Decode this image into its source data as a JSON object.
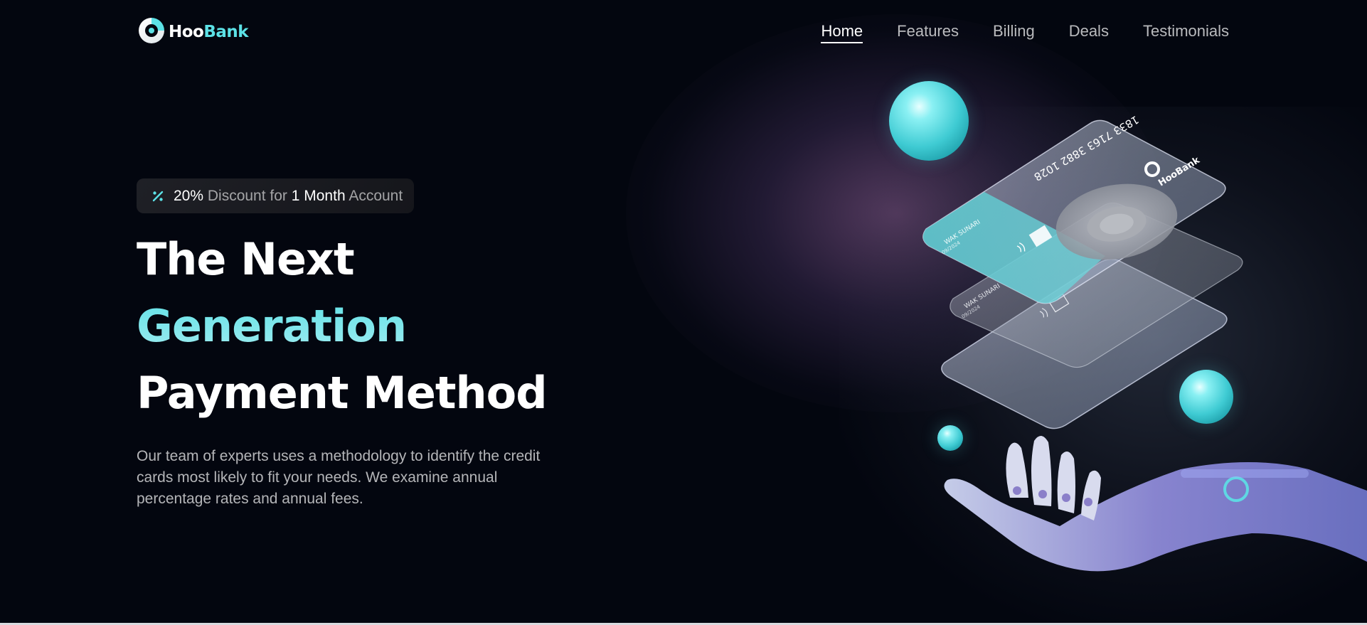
{
  "brand": {
    "name_part1": "Hoo",
    "name_part2": "Bank",
    "accent_color": "#5ce1e6"
  },
  "nav": {
    "links": [
      {
        "label": "Home",
        "active": true
      },
      {
        "label": "Features",
        "active": false
      },
      {
        "label": "Billing",
        "active": false
      },
      {
        "label": "Deals",
        "active": false
      },
      {
        "label": "Testimonials",
        "active": false
      }
    ]
  },
  "hero": {
    "badge": {
      "icon": "percent-icon",
      "percent": "20%",
      "text1": " Discount for ",
      "duration": "1 Month",
      "text2": " Account"
    },
    "title_line1": "The Next",
    "title_line2": "Generation",
    "title_line3": "Payment Method",
    "description": "Our team of experts uses a methodology to identify the credit cards most likely to fit your needs. We examine annual percentage rates and annual fees."
  },
  "illustration": {
    "card_number": "1833 7163 3882 1028",
    "card_brand": "HooBank",
    "card_holder": "WAK SUNARI",
    "card_expiry": "09/2024",
    "icons": [
      "robot-hand-icon",
      "credit-card-icon",
      "sphere-icon"
    ]
  }
}
